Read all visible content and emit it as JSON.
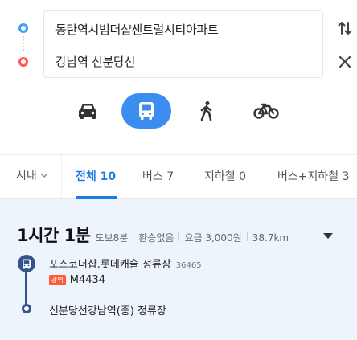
{
  "search": {
    "start": "동탄역시범더샵센트럴시티아파트",
    "end": "강남역 신분당선"
  },
  "modes": {
    "items": [
      "car-icon",
      "bus-icon",
      "walk-icon",
      "bike-icon"
    ],
    "selected": "bus",
    "accent": "#3b8ef0"
  },
  "tabs": {
    "region": "시내",
    "items": [
      {
        "label": "전체 10"
      },
      {
        "label": "버스 7"
      },
      {
        "label": "지하철 0"
      },
      {
        "label": "버스+지하철 3"
      }
    ],
    "active_color": "#1f7ae0"
  },
  "route": {
    "duration": "1시간 1분",
    "walk": "도보8분",
    "transfer": "환승없음",
    "fare": "요금 3,000원",
    "distance": "38.7km",
    "stop_start": "포스코더샵.롯데캐슬 정류장",
    "stop_start_id": "36465",
    "bus_type": "광역",
    "bus_number": "M4434",
    "stop_end": "신분당선강남역(중) 정류장",
    "line_color": "#36538c",
    "bus_type_color": "#ff5a3c"
  }
}
